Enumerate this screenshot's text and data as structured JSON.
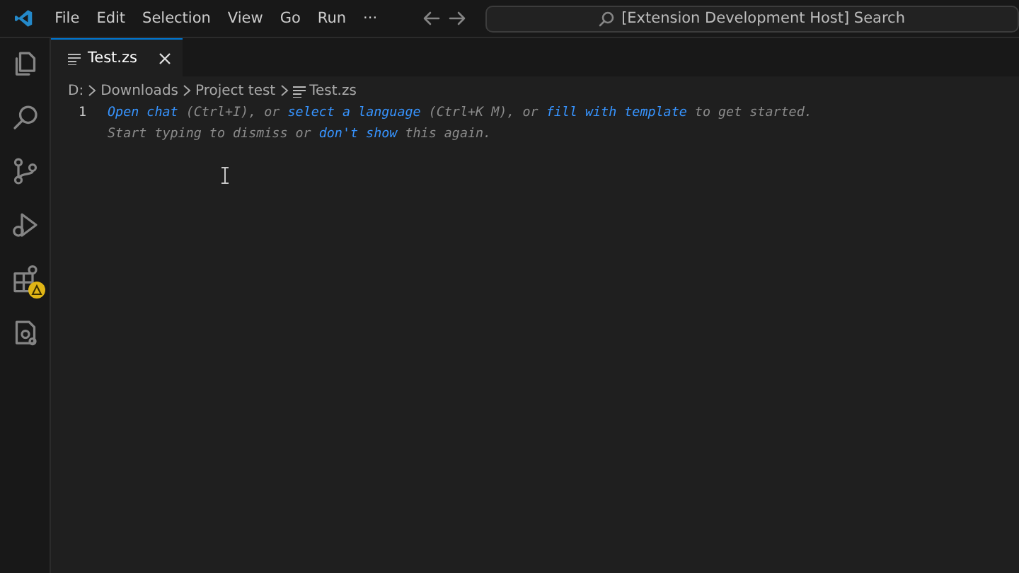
{
  "menu": [
    "File",
    "Edit",
    "Selection",
    "View",
    "Go",
    "Run",
    "···"
  ],
  "search": {
    "placeholder": "[Extension Development Host] Search"
  },
  "activity_bar": [
    {
      "kind": "files",
      "badge": false
    },
    {
      "kind": "search",
      "badge": false
    },
    {
      "kind": "source-control",
      "badge": false
    },
    {
      "kind": "run-debug",
      "badge": false
    },
    {
      "kind": "extensions",
      "badge": true
    },
    {
      "kind": "test-file",
      "badge": false
    }
  ],
  "tabs": [
    {
      "label": "Test.zs",
      "selected": true
    }
  ],
  "breadcrumbs": [
    "D:",
    "Downloads",
    "Project test",
    "Test.zs"
  ],
  "editor": {
    "line_numbers": [
      "1"
    ],
    "hint_lines": [
      [
        {
          "kind": "link",
          "text": "Open chat"
        },
        {
          "kind": "text",
          "text": " (Ctrl+I), or "
        },
        {
          "kind": "link",
          "text": "select a language"
        },
        {
          "kind": "text",
          "text": " (Ctrl+K M), or "
        },
        {
          "kind": "link",
          "text": "fill with template"
        },
        {
          "kind": "text",
          "text": " to get started."
        }
      ],
      [
        {
          "kind": "text",
          "text": "Start typing to dismiss or "
        },
        {
          "kind": "link",
          "text": "don't show"
        },
        {
          "kind": "text",
          "text": " this again."
        }
      ]
    ]
  }
}
